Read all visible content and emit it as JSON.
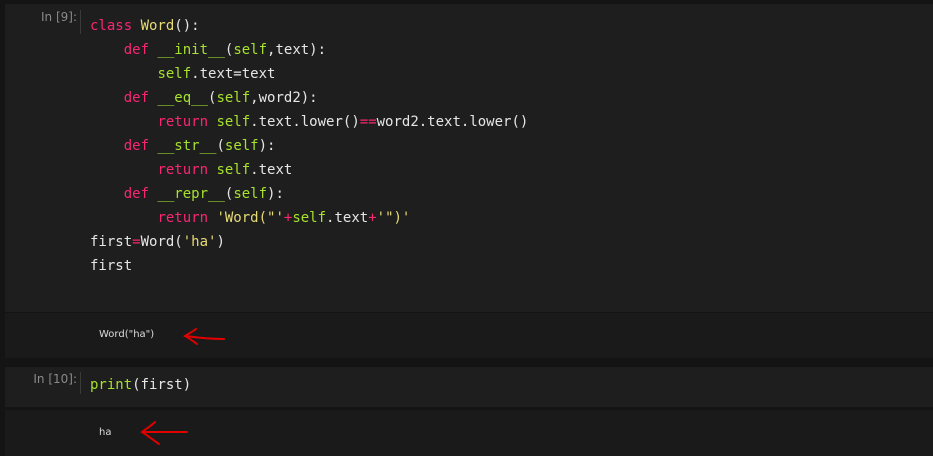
{
  "cells": [
    {
      "prompt": "In [9]:",
      "code": [
        [
          [
            "kw",
            "class "
          ],
          [
            "cls",
            "Word"
          ],
          [
            "op",
            "():"
          ]
        ],
        [
          [
            "op",
            "    "
          ],
          [
            "kw",
            "def "
          ],
          [
            "fn",
            "__init__"
          ],
          [
            "op",
            "("
          ],
          [
            "self",
            "self"
          ],
          [
            "op",
            ",text):"
          ]
        ],
        [
          [
            "op",
            "        "
          ],
          [
            "self",
            "self"
          ],
          [
            "op",
            ".text=text"
          ]
        ],
        [
          [
            "op",
            "    "
          ],
          [
            "kw",
            "def "
          ],
          [
            "fn",
            "__eq__"
          ],
          [
            "op",
            "("
          ],
          [
            "self",
            "self"
          ],
          [
            "op",
            ",word2):"
          ]
        ],
        [
          [
            "op",
            "        "
          ],
          [
            "kw",
            "return "
          ],
          [
            "self",
            "self"
          ],
          [
            "op",
            ".text.lower()"
          ],
          [
            "kw",
            "=="
          ],
          [
            "op",
            "word2.text.lower()"
          ]
        ],
        [
          [
            "op",
            "    "
          ],
          [
            "kw",
            "def "
          ],
          [
            "fn",
            "__str__"
          ],
          [
            "op",
            "("
          ],
          [
            "self",
            "self"
          ],
          [
            "op",
            "):"
          ]
        ],
        [
          [
            "op",
            "        "
          ],
          [
            "kw",
            "return "
          ],
          [
            "self",
            "self"
          ],
          [
            "op",
            ".text"
          ]
        ],
        [
          [
            "op",
            "    "
          ],
          [
            "kw",
            "def "
          ],
          [
            "fn",
            "__repr__"
          ],
          [
            "op",
            "("
          ],
          [
            "self",
            "self"
          ],
          [
            "op",
            "):"
          ]
        ],
        [
          [
            "op",
            "        "
          ],
          [
            "kw",
            "return "
          ],
          [
            "str",
            "'Word(\"'"
          ],
          [
            "kw",
            "+"
          ],
          [
            "self",
            "self"
          ],
          [
            "op",
            ".text"
          ],
          [
            "kw",
            "+"
          ],
          [
            "str",
            "'\")'"
          ]
        ],
        [
          [
            "op",
            "first"
          ],
          [
            "kw",
            "="
          ],
          [
            "op",
            "Word("
          ],
          [
            "str",
            "'ha'"
          ],
          [
            "op",
            ")"
          ]
        ],
        [
          [
            "op",
            "first"
          ]
        ]
      ],
      "output": "Word(\"ha\")"
    },
    {
      "prompt": "In [10]:",
      "code": [
        [
          [
            "bi",
            "print"
          ],
          [
            "op",
            "(first)"
          ]
        ]
      ],
      "output": "ha"
    }
  ],
  "colors": {
    "keyword": "#f92672",
    "class_name": "#e6db74",
    "function_name": "#a6e22e",
    "string": "#e6db74",
    "annotation_arrow": "#e00000",
    "cell_background": "#1e1e1e",
    "page_background": "#141414"
  },
  "icons": [
    "annotation-arrow-icon",
    "annotation-arrow-icon"
  ]
}
